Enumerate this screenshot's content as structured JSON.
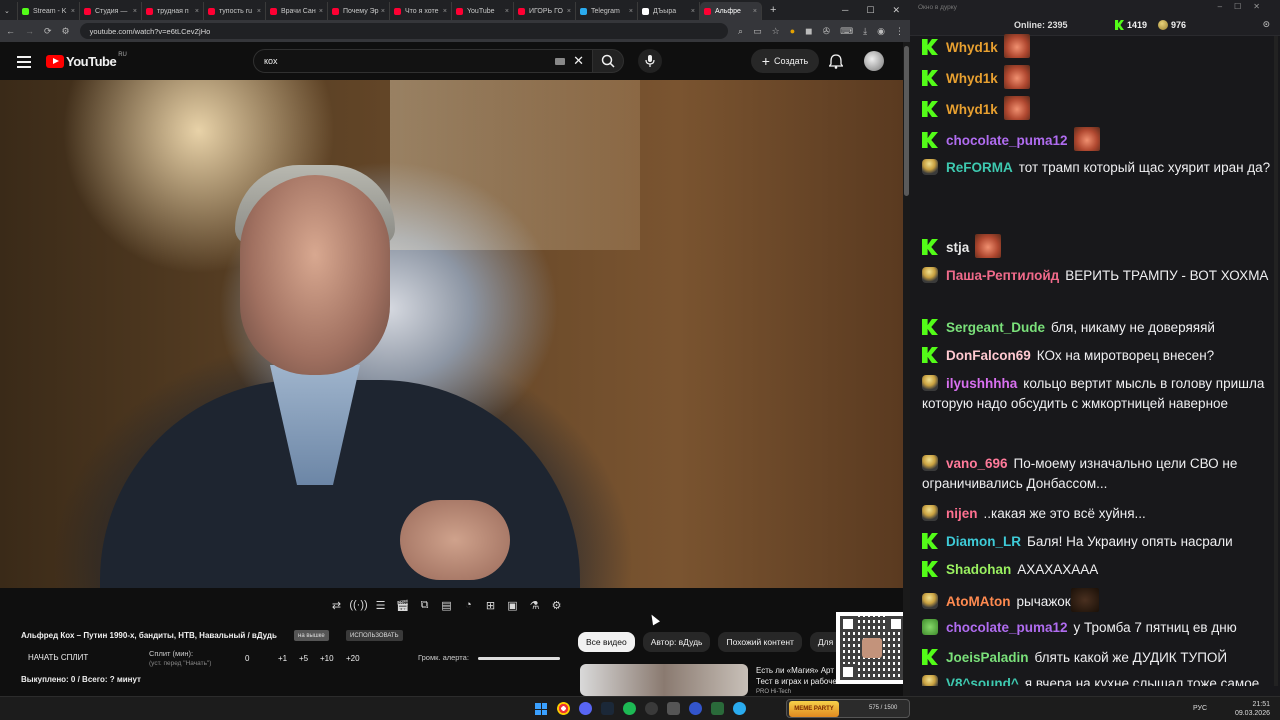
{
  "browser": {
    "tabs": [
      {
        "label": "Stream - K",
        "color": "#53fc18"
      },
      {
        "label": "Студия —",
        "color": "#ff0033"
      },
      {
        "label": "трудная п",
        "color": "#ff0033"
      },
      {
        "label": "тупость ru",
        "color": "#ff0033"
      },
      {
        "label": "Врачи Сан",
        "color": "#ff0033"
      },
      {
        "label": "Почему Эр",
        "color": "#ff0033"
      },
      {
        "label": "Что я хоте",
        "color": "#ff0033"
      },
      {
        "label": "YouTube",
        "color": "#ff0033"
      },
      {
        "label": "ИГОРЬ ГО",
        "color": "#ff0033"
      },
      {
        "label": "Telegram",
        "color": "#2aabee"
      },
      {
        "label": "ДЪыра",
        "color": "#ffffff"
      },
      {
        "label": "Альфре",
        "color": "#ff0033",
        "active": true
      }
    ],
    "url": "youtube.com/watch?v=e6tLCevZjHo"
  },
  "youtube": {
    "logo_word": "YouTube",
    "region": "RU",
    "search_query": "кох",
    "create_label": "Создать"
  },
  "panel": {
    "video_title": "Альфред Кох – Путин 1990-х, бандиты, НТВ, Навальный / вДудь",
    "pill1": "на вышке",
    "pill2": "ИСПОЛЬЗОВАТЬ",
    "start_split": "НАЧАТЬ СПЛИТ",
    "split_label": "Сплит (мин):",
    "split_sub": "(уст. перед \"Начать\")",
    "split_values": [
      "0",
      "+1",
      "+5",
      "+10",
      "+20"
    ],
    "alert_volume_label": "Громк. алерта:",
    "alert_volume": 1.0,
    "bought": "Выкуплено: 0 / Всего: ? минут"
  },
  "chips": [
    "Все видео",
    "Автор: вДудь",
    "Похожий контент",
    "Для в"
  ],
  "recommendation": {
    "line1": "Есть ли «Магия» Арт",
    "line2": "Тест в играх и рабочем ПО",
    "line3": "PRO Hi-Tech"
  },
  "chat": {
    "window_title": "Окно в дурку",
    "online_label": "Online:",
    "online_count": "2395",
    "viewers_k": "1419",
    "viewers_p": "976",
    "messages": [
      {
        "user": "Whyd1k",
        "color": "#e8a030",
        "badge": "k",
        "text": "",
        "emote": "face"
      },
      {
        "user": "Whyd1k",
        "color": "#e8a030",
        "badge": "k",
        "text": "",
        "emote": "face"
      },
      {
        "user": "Whyd1k",
        "color": "#e8a030",
        "badge": "k",
        "text": "",
        "emote": "face"
      },
      {
        "user": "chocolate_puma12",
        "color": "#b06cf0",
        "badge": "k",
        "text": "",
        "emote": "face"
      },
      {
        "user": "ReFORMA",
        "color": "#3ec9b0",
        "badge": "p",
        "text": "тот трамп который щас хуярит иран да?"
      },
      {
        "user": "stja",
        "color": "#e8e8e8",
        "badge": "k",
        "text": "",
        "emote": "face"
      },
      {
        "user": "Паша-Рептилойд",
        "color": "#f06a8a",
        "badge": "p",
        "text": "ВЕРИТЬ ТРАМПУ - ВОТ ХОХМА"
      },
      {
        "user": "Sergeant_Dude",
        "color": "#7ae07a",
        "badge": "k",
        "text": "бля, никаму не доверяяяй"
      },
      {
        "user": "DonFalcon69",
        "color": "#ffc8d0",
        "badge": "k",
        "text": "КОх на миротворец внесен?"
      },
      {
        "user": "ilyushhhha",
        "color": "#d870f0",
        "badge": "p",
        "text": "кольцо вертит мысль в голову пришла которую надо обсудить с жмкортницей наверное"
      },
      {
        "user": "vano_696",
        "color": "#ff7a9a",
        "badge": "p",
        "text": "По-моему изначально цели СВО не ограничивались Донбассом..."
      },
      {
        "user": "nijen",
        "color": "#ff7090",
        "badge": "p",
        "text": "..какая же это всё хуйня..."
      },
      {
        "user": "Diamon_LR",
        "color": "#3ecbd8",
        "badge": "k",
        "text": "Баля! На Украину опять насрали"
      },
      {
        "user": "Shadohan",
        "color": "#9af060",
        "badge": "k",
        "text": "АХАХАХААА"
      },
      {
        "user": "AtoMAton",
        "color": "#ff8a50",
        "badge": "p",
        "text": "рычажок",
        "emote": "dark"
      },
      {
        "user": "chocolate_puma12",
        "color": "#b06cf0",
        "badge": "f",
        "text": "у Тромба 7 пятниц ев дню"
      },
      {
        "user": "JoeisPaladin",
        "color": "#7ae07a",
        "badge": "k",
        "text": "блять какой же ДУДИК ТУПОЙ"
      },
      {
        "user": "V8^sound^",
        "color": "#3ec9b0",
        "badge": "p",
        "text": "я вчера на кухне слышал тоже самое. уровень моей кухни",
        "emote": "banana"
      }
    ]
  },
  "taskbar": {
    "widget_text": "MEME PARTY",
    "widget_count": "575 / 1500",
    "lang": "РУС",
    "time": "21:51",
    "date": "09.03.2026"
  }
}
